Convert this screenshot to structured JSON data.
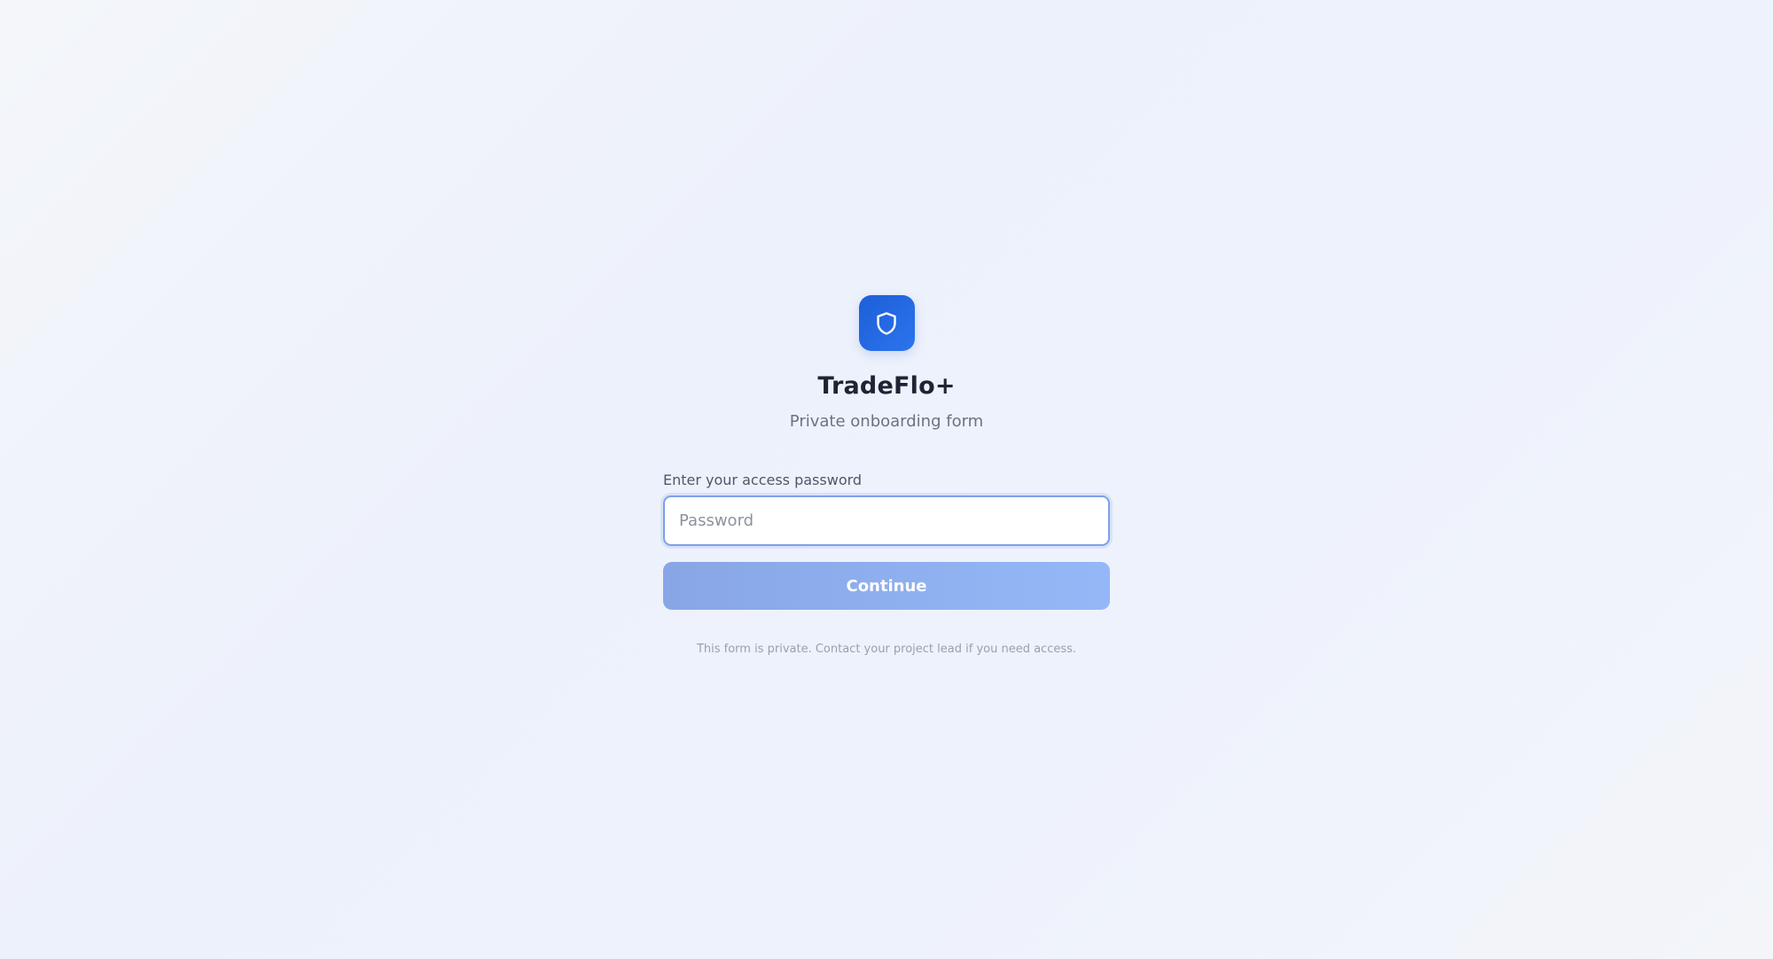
{
  "app": {
    "title": "TradeFlo+",
    "subtitle": "Private onboarding form",
    "logo_icon": "shield-icon",
    "accent_color": "#1d5fd8"
  },
  "form": {
    "label": "Enter your access password",
    "password": {
      "value": "",
      "placeholder": "Password"
    },
    "continue_label": "Continue",
    "footnote": "This form is private. Contact your project lead if you need access."
  }
}
